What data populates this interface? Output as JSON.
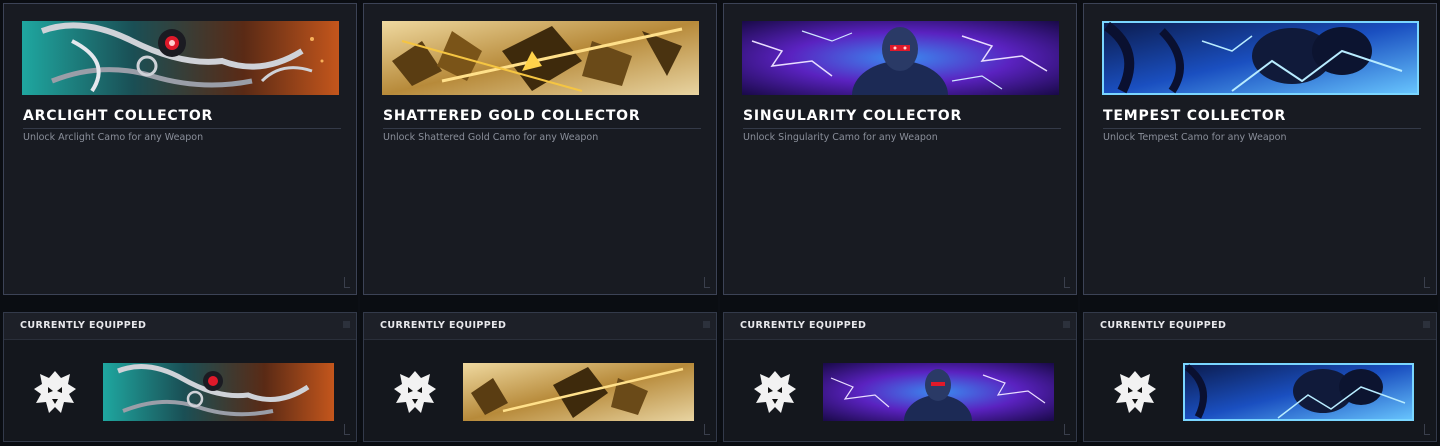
{
  "cards": [
    {
      "title": "ARCLIGHT COLLECTOR",
      "description": "Unlock Arclight Camo for any Weapon",
      "banner": "arclight-camo-image",
      "equipped_label": "CURRENTLY EQUIPPED",
      "emblem": "wolf-emblem-icon",
      "colors": {
        "primary": "#1fa7a0",
        "secondary": "#c4561c",
        "accent": "#e0192a"
      }
    },
    {
      "title": "SHATTERED GOLD COLLECTOR",
      "description": "Unlock Shattered Gold Camo for any Weapon",
      "banner": "shattered-gold-camo-image",
      "equipped_label": "CURRENTLY EQUIPPED",
      "emblem": "wolf-emblem-icon",
      "colors": {
        "primary": "#d9b35a",
        "secondary": "#6a4a18",
        "accent": "#f5d27a"
      }
    },
    {
      "title": "SINGULARITY COLLECTOR",
      "description": "Unlock Singularity Camo for any Weapon",
      "banner": "singularity-camo-image",
      "equipped_label": "CURRENTLY EQUIPPED",
      "emblem": "wolf-emblem-icon",
      "colors": {
        "primary": "#6a2bd6",
        "secondary": "#2a7be0",
        "accent": "#e0192a"
      }
    },
    {
      "title": "TEMPEST COLLECTOR",
      "description": "Unlock Tempest Camo for any Weapon",
      "banner": "tempest-camo-image",
      "equipped_label": "CURRENTLY EQUIPPED",
      "emblem": "wolf-emblem-icon",
      "colors": {
        "primary": "#1a6fe0",
        "secondary": "#0b1a4a",
        "accent": "#7ad6ff"
      }
    }
  ]
}
